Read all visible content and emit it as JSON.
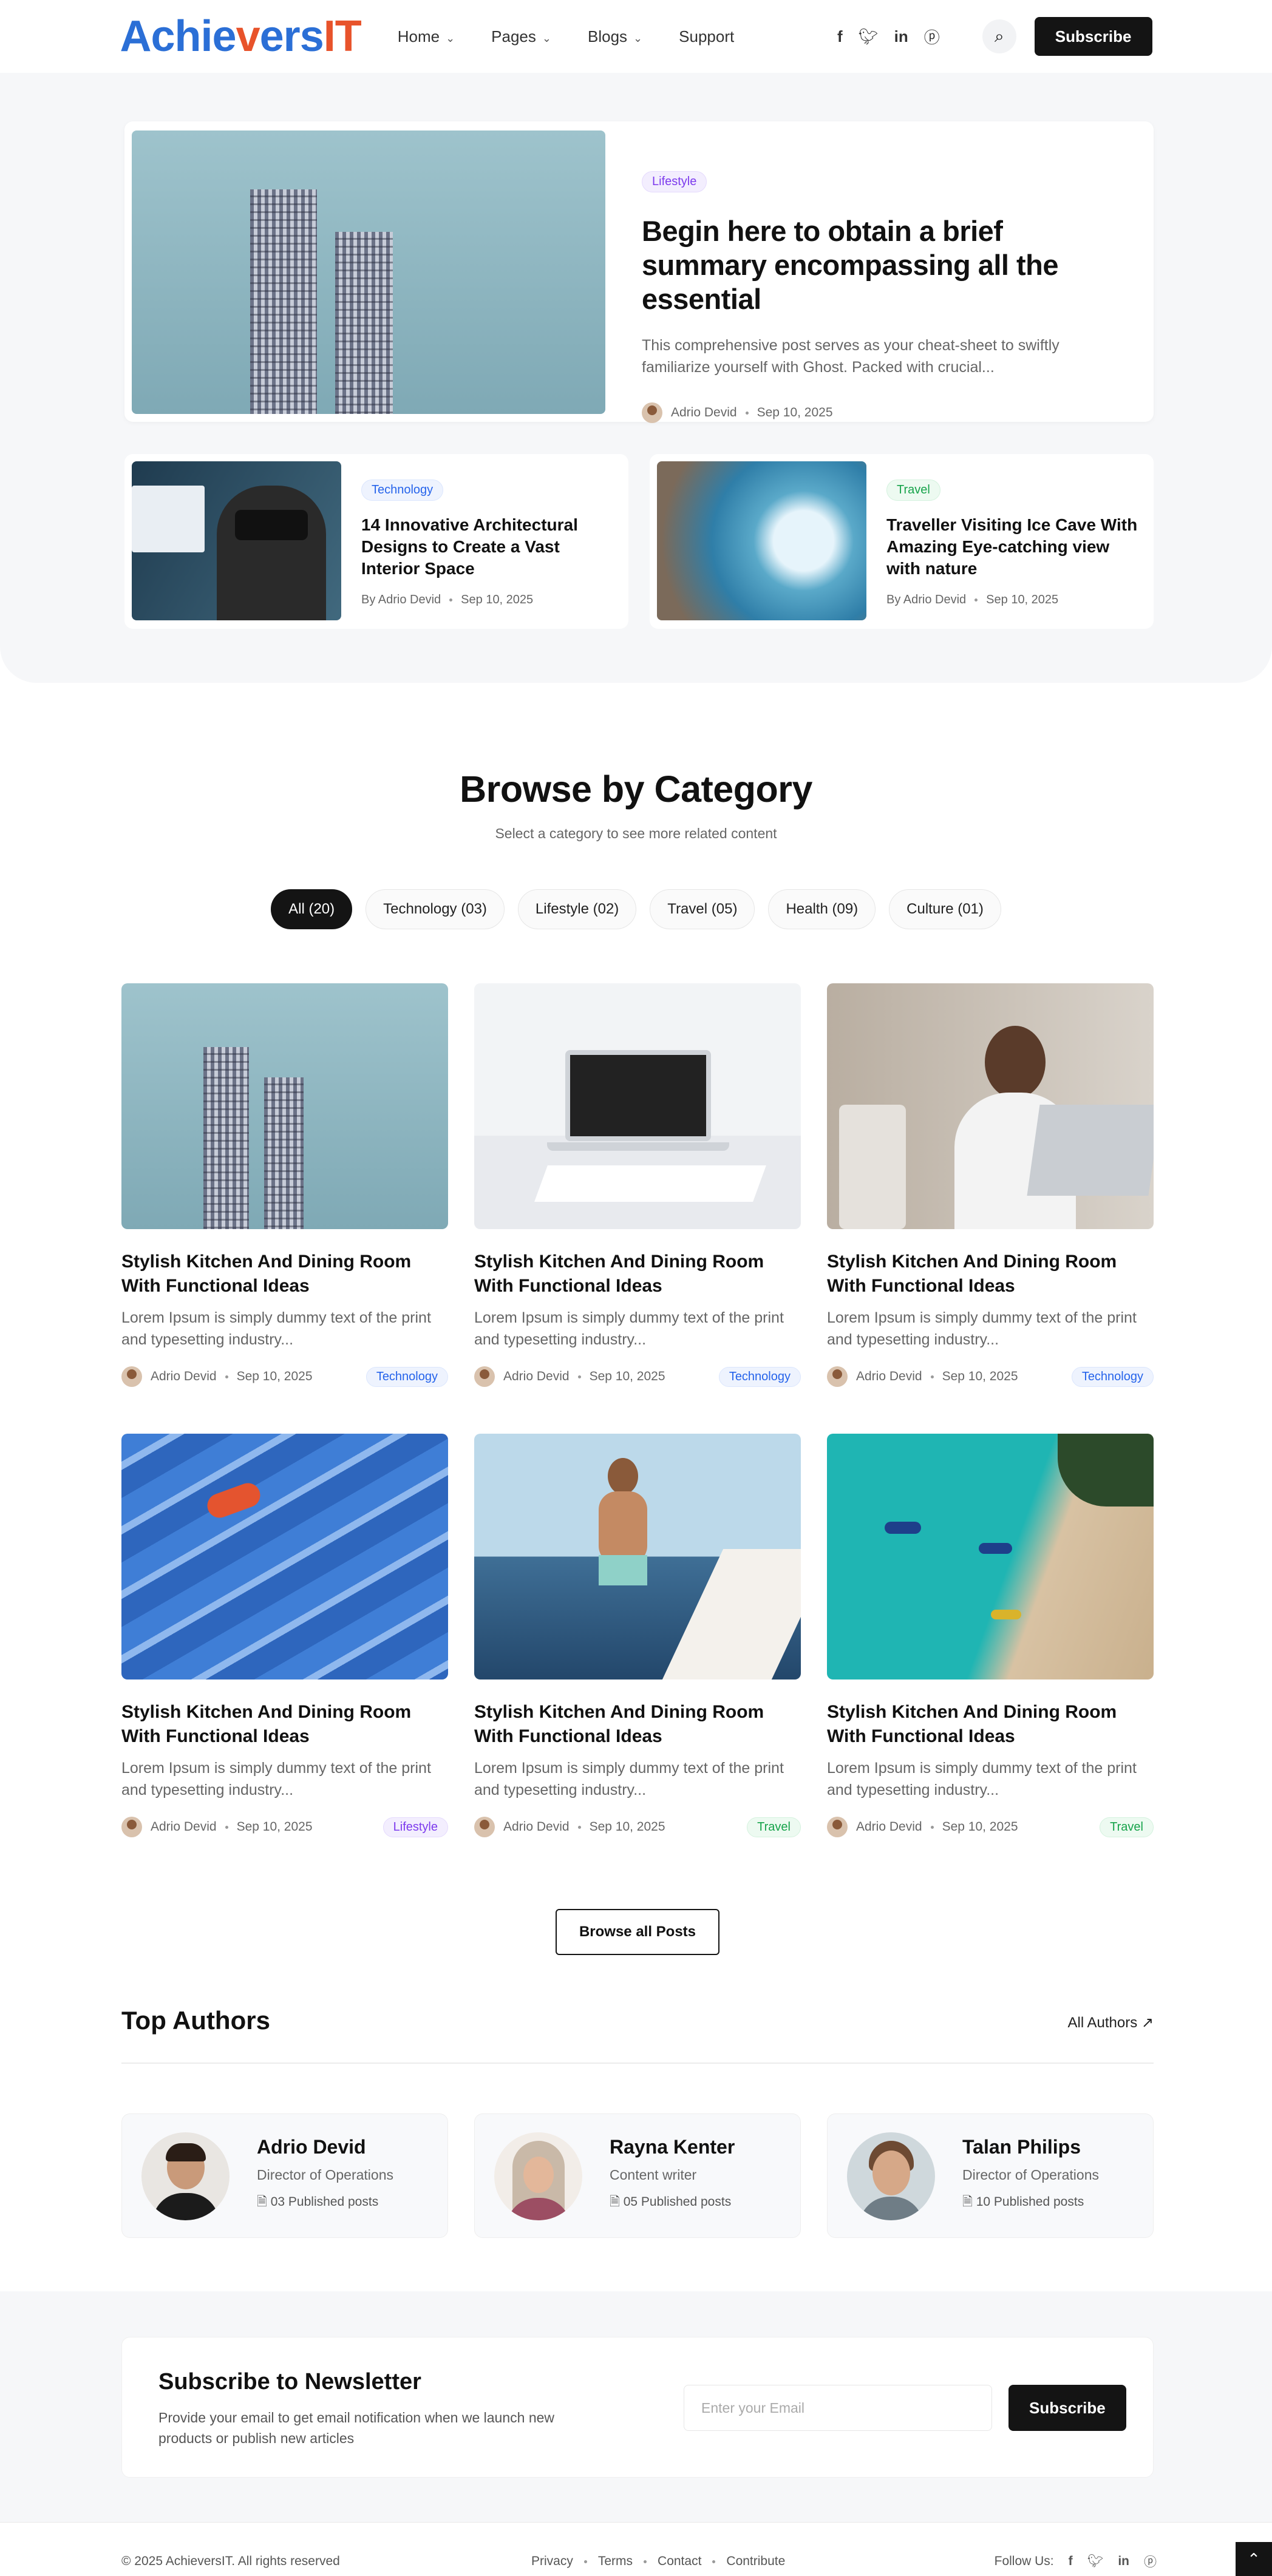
{
  "header": {
    "logo_a": "Achie",
    "logo_v": "v",
    "logo_b": "ers",
    "logo_c": "IT",
    "nav": [
      "Home",
      "Pages",
      "Blogs",
      "Support"
    ],
    "social_icons": [
      "facebook-icon",
      "twitter-icon",
      "linkedin-icon",
      "pinterest-icon"
    ],
    "subscribe_label": "Subscribe"
  },
  "hero": {
    "featured": {
      "tag": "Lifestyle",
      "title": "Begin here to obtain a brief summary encompassing all the essential",
      "excerpt": "This comprehensive post serves as your cheat-sheet to swiftly familiarize yourself with Ghost. Packed with crucial...",
      "author": "Adrio Devid",
      "date": "Sep 10, 2025"
    },
    "side": [
      {
        "tag": "Technology",
        "title": "14 Innovative Architectural Designs to Create a Vast Interior Space",
        "author": "By Adrio Devid",
        "date": "Sep 10, 2025"
      },
      {
        "tag": "Travel",
        "title": "Traveller Visiting Ice Cave With Amazing Eye-catching view with nature",
        "author": "By Adrio Devid",
        "date": "Sep 10, 2025"
      }
    ]
  },
  "category": {
    "title": "Browse by Category",
    "subtitle": "Select a category to see more related content",
    "chips": [
      "All (20)",
      "Technology (03)",
      "Lifestyle (02)",
      "Travel (05)",
      "Health (09)",
      "Culture (01)"
    ],
    "posts": [
      {
        "title": "Stylish Kitchen And Dining Room With Functional Ideas",
        "excerpt": "Lorem Ipsum is simply dummy text of the print and typesetting industry...",
        "author": "Adrio Devid",
        "date": "Sep 10, 2025",
        "tag": "Technology"
      },
      {
        "title": "Stylish Kitchen And Dining Room With Functional Ideas",
        "excerpt": "Lorem Ipsum is simply dummy text of the print and typesetting industry...",
        "author": "Adrio Devid",
        "date": "Sep 10, 2025",
        "tag": "Technology"
      },
      {
        "title": "Stylish Kitchen And Dining Room With Functional Ideas",
        "excerpt": "Lorem Ipsum is simply dummy text of the print and typesetting industry...",
        "author": "Adrio Devid",
        "date": "Sep 10, 2025",
        "tag": "Technology"
      },
      {
        "title": "Stylish Kitchen And Dining Room With Functional Ideas",
        "excerpt": "Lorem Ipsum is simply dummy text of the print and typesetting industry...",
        "author": "Adrio Devid",
        "date": "Sep 10, 2025",
        "tag": "Lifestyle"
      },
      {
        "title": "Stylish Kitchen And Dining Room With Functional Ideas",
        "excerpt": "Lorem Ipsum is simply dummy text of the print and typesetting industry...",
        "author": "Adrio Devid",
        "date": "Sep 10, 2025",
        "tag": "Travel"
      },
      {
        "title": "Stylish Kitchen And Dining Room With Functional Ideas",
        "excerpt": "Lorem Ipsum is simply dummy text of the print and typesetting industry...",
        "author": "Adrio Devid",
        "date": "Sep 10, 2025",
        "tag": "Travel"
      }
    ],
    "browse_all": "Browse all Posts"
  },
  "authors": {
    "title": "Top Authors",
    "all_label": "All Authors",
    "list": [
      {
        "name": "Adrio Devid",
        "role": "Director of Operations",
        "posts": "03 Published posts"
      },
      {
        "name": "Rayna Kenter",
        "role": "Content writer",
        "posts": "05 Published posts"
      },
      {
        "name": "Talan Philips",
        "role": "Director of Operations",
        "posts": "10 Published posts"
      }
    ]
  },
  "newsletter": {
    "title": "Subscribe to Newsletter",
    "text": "Provide your email to get email notification when we launch new products or publish new articles",
    "placeholder": "Enter your Email",
    "button": "Subscribe"
  },
  "footer": {
    "copyright": "© 2025 AchieversIT. All rights reserved",
    "links": [
      "Privacy",
      "Terms",
      "Contact",
      "Contribute"
    ],
    "follow": "Follow Us:"
  },
  "colors": {
    "logo_blue": "#2b6fd6",
    "logo_orange": "#e8532b",
    "dark": "#141414"
  }
}
